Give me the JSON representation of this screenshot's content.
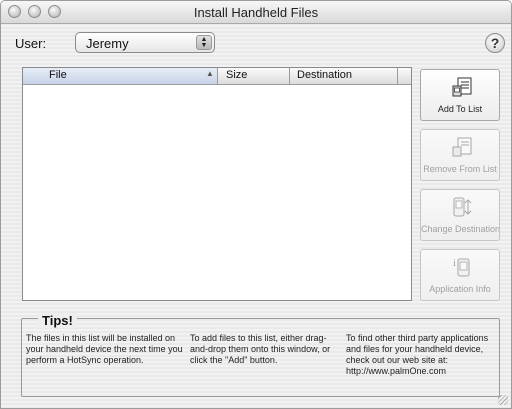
{
  "window": {
    "title": "Install Handheld Files"
  },
  "user": {
    "label": "User:",
    "selected": "Jeremy"
  },
  "help": {
    "glyph": "?"
  },
  "filelist": {
    "columns": [
      "File",
      "Size",
      "Destination"
    ],
    "sorted_column": "File",
    "rows": []
  },
  "buttons": {
    "add": "Add To List",
    "remove": "Remove From List",
    "change_dest": "Change Destination...",
    "app_info": "Application Info"
  },
  "tips": {
    "title": "Tips!",
    "tip1": "The files in this list will be installed on your handheld device the next time you perform a HotSync operation.",
    "tip2": "To add files to this list, either drag-and-drop them onto this window, or click the \"Add\" button.",
    "tip3": "To find other third party applications and files for your handheld device, check out our web site at: http://www.palmOne.com"
  },
  "icons": {
    "add": "add-file-icon",
    "remove": "remove-file-icon",
    "change_dest": "change-destination-icon",
    "app_info": "application-info-icon"
  }
}
